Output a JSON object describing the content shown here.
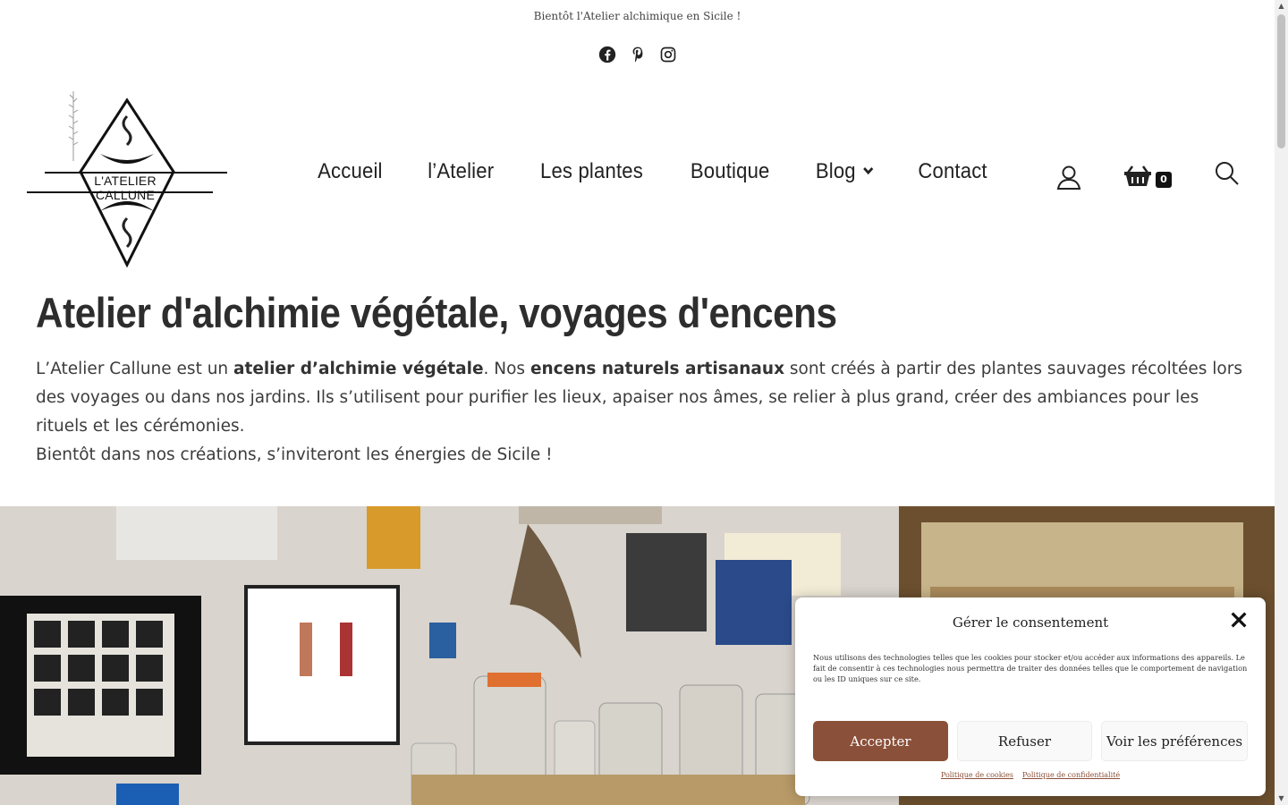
{
  "topbar": {
    "announcement": "Bientôt l'Atelier alchimique en Sicile !"
  },
  "social": {
    "icons": [
      "facebook-icon",
      "pinterest-icon",
      "instagram-icon"
    ]
  },
  "logo": {
    "text": "L'ATELIER CALLUNE"
  },
  "nav": {
    "items": [
      "Accueil",
      "l’Atelier",
      "Les plantes",
      "Boutique",
      "Blog",
      "Contact"
    ],
    "cart_count": "0"
  },
  "hero": {
    "title": "Atelier d'alchimie végétale, voyages d'encens",
    "p1_a": "L’Atelier Callune est un ",
    "p1_b": "atelier d’alchimie végétale",
    "p1_c": ". Nos ",
    "p1_d": "encens naturels artisanaux",
    "p1_e": " sont créés à partir des plantes sauvages récoltées lors des voyages ou dans nos jardins. Ils s’utilisent pour purifier les lieux, apaiser nos âmes, se relier à plus grand, créer des ambiances pour les rituels et les cérémonies.",
    "p2": "Bientôt dans nos créations, s’inviteront les énergies de Sicile !"
  },
  "consent": {
    "title": "Gérer le consentement",
    "text": "Nous utilisons des technologies telles que les cookies pour stocker et/ou accéder aux informations des appareils. Le fait de consentir à ces technologies nous permettra de traiter des données telles que le comportement de navigation ou les ID uniques sur ce site.",
    "accept": "Accepter",
    "refuse": "Refuser",
    "prefs": "Voir les préférences",
    "link_cookies": "Politique de cookies",
    "link_privacy": "Politique de confidentialité"
  },
  "colors": {
    "accent": "#8b5039",
    "text": "#2d2d2d"
  }
}
